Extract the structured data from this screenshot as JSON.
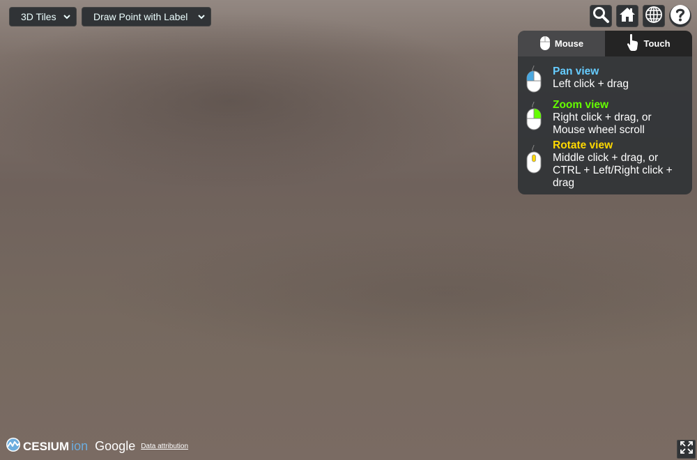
{
  "toolbar_left": {
    "dropdowns": [
      {
        "selected": "3D Tiles"
      },
      {
        "selected": "Draw Point with Label"
      }
    ]
  },
  "toolbar_right": {
    "buttons": [
      {
        "icon": "search-icon"
      },
      {
        "icon": "home-icon"
      },
      {
        "icon": "globe-icon"
      },
      {
        "icon": "help-icon"
      }
    ]
  },
  "navigation_help": {
    "tabs": [
      {
        "label": "Mouse",
        "active": true
      },
      {
        "label": "Touch",
        "active": false
      }
    ],
    "items": [
      {
        "title": "Pan view",
        "color": "#66ccff",
        "lines": [
          "Left click + drag"
        ]
      },
      {
        "title": "Zoom view",
        "color": "#65fd00",
        "lines": [
          "Right click + drag, or",
          "Mouse wheel scroll"
        ]
      },
      {
        "title": "Rotate view",
        "color": "#ffd800",
        "lines": [
          "Middle click + drag, or",
          "CTRL + Left/Right click +",
          "drag"
        ]
      }
    ]
  },
  "credits": {
    "cesium": "CESIUM",
    "ion": "ion",
    "google": "Google",
    "attribution": "Data attribution"
  }
}
